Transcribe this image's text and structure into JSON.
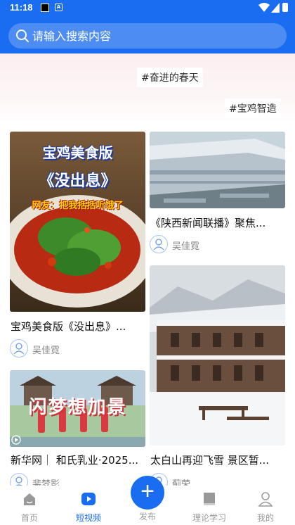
{
  "status_bar": {
    "time": "11:18",
    "notif_icon": "A"
  },
  "search": {
    "placeholder": "请输入搜索内容"
  },
  "tags": [
    "#奋进的春天",
    "#宝鸡智造"
  ],
  "cards": [
    {
      "title": "宝鸡美食版《没出息》...",
      "author": "吴佳霓",
      "image": "food-bowl-image",
      "overlay_title": "宝鸡美食版",
      "overlay_subtitle": "《没出息》",
      "overlay_caption": "网友：把我括括听饿了"
    },
    {
      "title": "《陕西新闻联播》聚焦...",
      "author": "吴佳霓",
      "image": "factory-aerial-image"
    },
    {
      "title": "新华网｜ 和氏乳业·2025...",
      "author": "裴梦影",
      "image": "dancers-image",
      "overlay_text": "闪梦想加景"
    },
    {
      "title": "太白山再迎飞雪 景区暂...",
      "author": "蓟荣",
      "image": "snow-building-image"
    }
  ],
  "nav": {
    "items": [
      {
        "label": "首页",
        "icon": "home-icon"
      },
      {
        "label": "短视频",
        "icon": "video-icon"
      },
      {
        "label": "发布",
        "icon": "plus-icon"
      },
      {
        "label": "理论学习",
        "icon": "book-icon"
      },
      {
        "label": "我的",
        "icon": "user-icon"
      }
    ],
    "active": "短视频"
  },
  "colors": {
    "brand": "#1a6cf0",
    "nav_inactive": "#999999"
  }
}
